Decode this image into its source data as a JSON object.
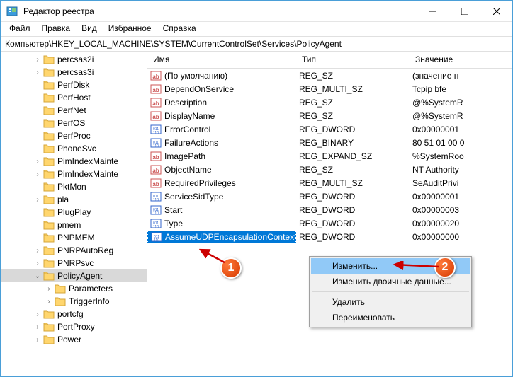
{
  "window": {
    "title": "Редактор реестра"
  },
  "menu": {
    "file": "Файл",
    "edit": "Правка",
    "view": "Вид",
    "favorites": "Избранное",
    "help": "Справка"
  },
  "address": "Компьютер\\HKEY_LOCAL_MACHINE\\SYSTEM\\CurrentControlSet\\Services\\PolicyAgent",
  "tree": [
    {
      "n": "percsas2i",
      "c": 1
    },
    {
      "n": "percsas3i",
      "c": 1
    },
    {
      "n": "PerfDisk",
      "c": 0
    },
    {
      "n": "PerfHost",
      "c": 0
    },
    {
      "n": "PerfNet",
      "c": 0
    },
    {
      "n": "PerfOS",
      "c": 0
    },
    {
      "n": "PerfProc",
      "c": 0
    },
    {
      "n": "PhoneSvc",
      "c": 0
    },
    {
      "n": "PimIndexMainte",
      "c": 1
    },
    {
      "n": "PimIndexMainte",
      "c": 1
    },
    {
      "n": "PktMon",
      "c": 0
    },
    {
      "n": "pla",
      "c": 1
    },
    {
      "n": "PlugPlay",
      "c": 0
    },
    {
      "n": "pmem",
      "c": 0
    },
    {
      "n": "PNPMEM",
      "c": 0
    },
    {
      "n": "PNRPAutoReg",
      "c": 1
    },
    {
      "n": "PNRPsvc",
      "c": 1
    },
    {
      "n": "PolicyAgent",
      "c": 1,
      "sel": 1,
      "open": 1
    },
    {
      "n": "Parameters",
      "c": 1,
      "d": 1
    },
    {
      "n": "TriggerInfo",
      "c": 1,
      "d": 1
    },
    {
      "n": "portcfg",
      "c": 1
    },
    {
      "n": "PortProxy",
      "c": 1
    },
    {
      "n": "Power",
      "c": 1
    }
  ],
  "cols": {
    "name": "Имя",
    "type": "Тип",
    "value": "Значение"
  },
  "rows": [
    {
      "i": "s",
      "n": "(По умолчанию)",
      "t": "REG_SZ",
      "v": "(значение н"
    },
    {
      "i": "s",
      "n": "DependOnService",
      "t": "REG_MULTI_SZ",
      "v": "Tcpip bfe"
    },
    {
      "i": "s",
      "n": "Description",
      "t": "REG_SZ",
      "v": "@%SystemR"
    },
    {
      "i": "s",
      "n": "DisplayName",
      "t": "REG_SZ",
      "v": "@%SystemR"
    },
    {
      "i": "b",
      "n": "ErrorControl",
      "t": "REG_DWORD",
      "v": "0x00000001"
    },
    {
      "i": "b",
      "n": "FailureActions",
      "t": "REG_BINARY",
      "v": "80 51 01 00 0"
    },
    {
      "i": "s",
      "n": "ImagePath",
      "t": "REG_EXPAND_SZ",
      "v": "%SystemRoo"
    },
    {
      "i": "s",
      "n": "ObjectName",
      "t": "REG_SZ",
      "v": "NT Authority"
    },
    {
      "i": "s",
      "n": "RequiredPrivileges",
      "t": "REG_MULTI_SZ",
      "v": "SeAuditPrivi"
    },
    {
      "i": "b",
      "n": "ServiceSidType",
      "t": "REG_DWORD",
      "v": "0x00000001"
    },
    {
      "i": "b",
      "n": "Start",
      "t": "REG_DWORD",
      "v": "0x00000003"
    },
    {
      "i": "b",
      "n": "Type",
      "t": "REG_DWORD",
      "v": "0x00000020"
    },
    {
      "i": "b",
      "n": "AssumeUDPEncapsulationContextOnS...",
      "t": "REG_DWORD",
      "v": "0x00000000",
      "sel": 1
    }
  ],
  "ctx": {
    "modify": "Изменить...",
    "modifyBin": "Изменить двоичные данные...",
    "delete": "Удалить",
    "rename": "Переименовать"
  },
  "callouts": {
    "c1": "1",
    "c2": "2"
  }
}
